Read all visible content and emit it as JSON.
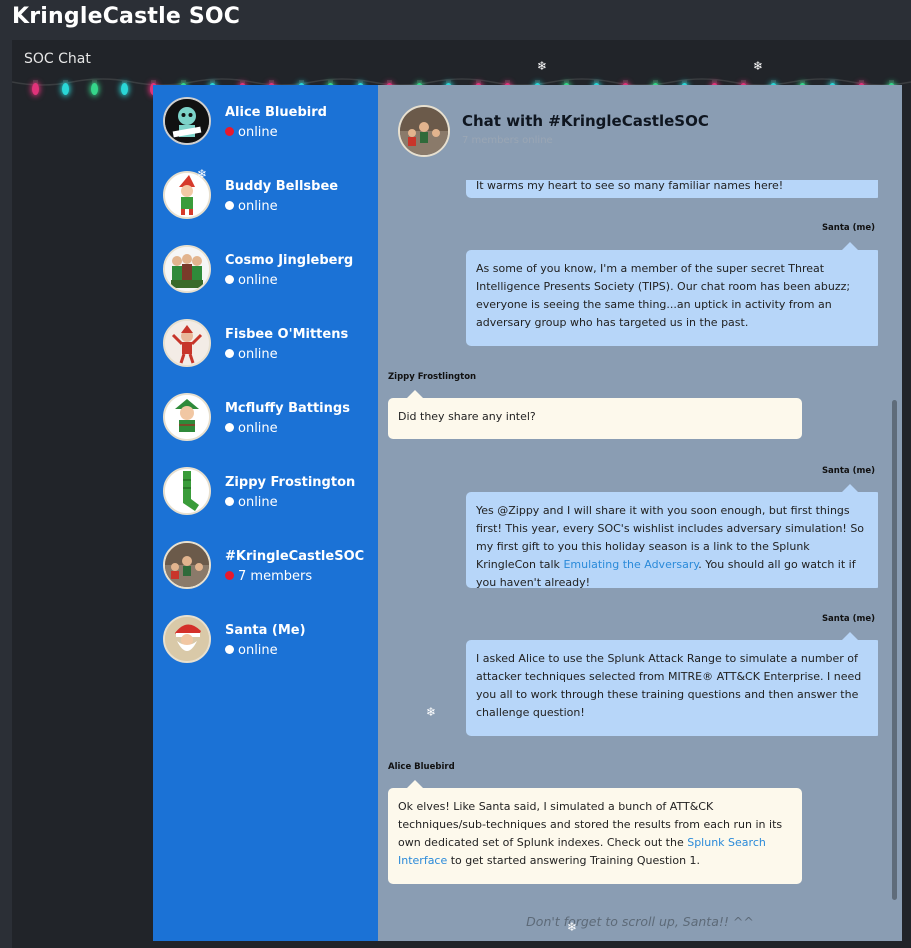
{
  "app_title": "KringleCastle SOC",
  "panel_title": "SOC Chat",
  "contacts": [
    {
      "name": "Alice Bluebird",
      "status": "online",
      "status_color": "#e8192c"
    },
    {
      "name": "Buddy Bellsbee",
      "status": "online",
      "status_color": "#ffffff"
    },
    {
      "name": "Cosmo Jingleberg",
      "status": "online",
      "status_color": "#ffffff"
    },
    {
      "name": "Fisbee O'Mittens",
      "status": "online",
      "status_color": "#ffffff"
    },
    {
      "name": "Mcfluffy Battings",
      "status": "online",
      "status_color": "#ffffff"
    },
    {
      "name": "Zippy Frostington",
      "status": "online",
      "status_color": "#ffffff"
    },
    {
      "name": "#KringleCastleSOC",
      "status": "7 members",
      "status_color": "#e8192c"
    },
    {
      "name": "Santa (Me)",
      "status": "online",
      "status_color": "#ffffff"
    }
  ],
  "chat": {
    "title": "Chat with #KringleCastleSOC",
    "subtitle": "7 members online",
    "messages": [
      {
        "sender": "",
        "text": "It warms my heart to see so many familiar names here!",
        "mine": true
      },
      {
        "sender": "Santa (me)",
        "text": "As some of you know, I'm a member of the super secret Threat Intelligence Presents Society (TIPS). Our chat room has been abuzz; everyone is seeing the same thing...an uptick in activity from an adversary group who has targeted us in the past.",
        "mine": true
      },
      {
        "sender": "Zippy Frostlington",
        "text": "Did they share any intel?",
        "mine": false
      },
      {
        "sender": "Santa (me)",
        "text_before": "Yes @Zippy and I will share it with you soon enough, but first things first! This year, every SOC's wishlist includes adversary simulation! So my first gift to you this holiday season is a link to the Splunk KringleCon talk ",
        "link": "Emulating the Adversary",
        "text_after": ". You should all go watch it if you haven't already!",
        "mine": true
      },
      {
        "sender": "Santa (me)",
        "text": "I asked Alice to use the Splunk Attack Range to simulate a number of attacker techniques selected from MITRE® ATT&CK Enterprise. I need you all to work through these training questions and then answer the challenge question!",
        "mine": true
      },
      {
        "sender": "Alice Bluebird",
        "text_before": "Ok elves! Like Santa said, I simulated a bunch of ATT&CK techniques/sub-techniques and stored the results from each run in its own dedicated set of Splunk indexes. Check out the ",
        "link": "Splunk Search Interface",
        "text_after": " to get started answering Training Question 1.",
        "mine": false
      }
    ],
    "footer_note": "Don't forget to scroll up, Santa!! ^^"
  },
  "colors": {
    "sidebar": "#1b72d6",
    "chat_bg": "#8a9db3",
    "my_bubble": "#b7d6f9",
    "their_bubble": "#fdf9ec",
    "link": "#2a8ad9"
  }
}
